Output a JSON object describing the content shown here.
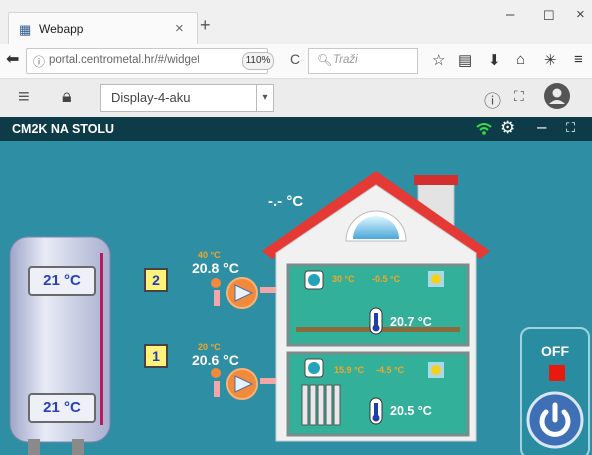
{
  "browser": {
    "tab_title": "Webapp",
    "url": "portal.centrometal.hr/#/widget",
    "zoom": "110%",
    "search_placeholder": "Traži"
  },
  "toolbar": {
    "display_name": "Display-4-aku"
  },
  "app": {
    "title": "CM2K NA STOLU"
  },
  "scene": {
    "outdoor_temp": "-.- °C",
    "tank": {
      "top_temp": "21 °C",
      "bottom_temp": "21 °C"
    },
    "circuits": [
      {
        "number": "2",
        "set_temp": "40 °C",
        "flow_temp": "20.8 °C",
        "room_setpoint": "30 °C",
        "room_offset": "-0.5 °C",
        "room_temp": "20.7 °C"
      },
      {
        "number": "1",
        "set_temp": "20 °C",
        "flow_temp": "20.6 °C",
        "room_setpoint": "15.9 °C",
        "room_offset": "-4.5 °C",
        "room_temp": "20.5 °C"
      }
    ],
    "power": {
      "status": "OFF"
    }
  },
  "colors": {
    "app_bar": "#0d3b47",
    "background": "#2e8fa4",
    "roof": "#e53935",
    "pump": "#f28a3c",
    "status_off": "#e8190f",
    "power_button": "#3f6fb5",
    "setpoint_text": "#f5a623"
  }
}
